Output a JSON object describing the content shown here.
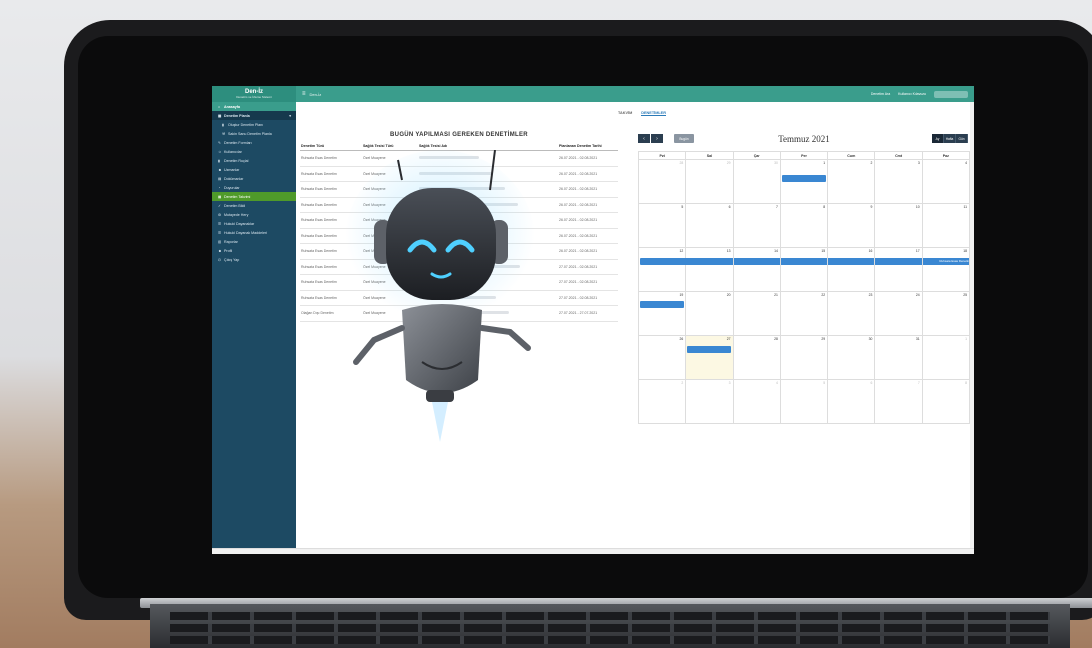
{
  "app": {
    "brand": "Den-İz",
    "brand_sub": "Denetim ve İzleme Sistemi",
    "breadcrumb": "Den-İz",
    "topbar_links": [
      "Denetim Ara",
      "Kullanıcı Kılavuzu"
    ]
  },
  "sidebar": {
    "items": [
      {
        "label": "Anasayfa",
        "icon": "home-icon",
        "kind": "active"
      },
      {
        "label": "Denetim Planla",
        "icon": "calendar-icon",
        "kind": "section"
      },
      {
        "label": "Oluştur Denetim Planı",
        "icon": "file-icon",
        "kind": "sub"
      },
      {
        "label": "Sakin Sanu Denetim Planla",
        "icon": "hammer-icon",
        "kind": "sub"
      },
      {
        "label": "Denetim Formları",
        "icon": "edit-icon",
        "kind": "normal"
      },
      {
        "label": "Kullanıcılar",
        "icon": "users-icon",
        "kind": "normal"
      },
      {
        "label": "Denetim Ruçlal",
        "icon": "file-icon",
        "kind": "normal"
      },
      {
        "label": "Uzmanlar",
        "icon": "user-icon",
        "kind": "normal"
      },
      {
        "label": "Dokümanlar",
        "icon": "doc-icon",
        "kind": "normal"
      },
      {
        "label": "Duyurular",
        "icon": "bell-icon",
        "kind": "normal"
      },
      {
        "label": "Denetim Takvimi",
        "icon": "calendar-icon",
        "kind": "highlight"
      },
      {
        "label": "Denetim Bildi",
        "icon": "check-icon",
        "kind": "normal"
      },
      {
        "label": "Mutayede Hery",
        "icon": "wrench-icon",
        "kind": "normal"
      },
      {
        "label": "Hukuki Dayanaklar",
        "icon": "list-icon",
        "kind": "normal"
      },
      {
        "label": "Hukuki Dayanak Maddeleri",
        "icon": "list-icon",
        "kind": "normal"
      },
      {
        "label": "Raporlar",
        "icon": "chart-icon",
        "kind": "normal"
      },
      {
        "label": "Profil",
        "icon": "user-icon",
        "kind": "normal"
      },
      {
        "label": "Çıkış Yap",
        "icon": "power-icon",
        "kind": "normal"
      }
    ]
  },
  "tabs": [
    "TAKVİM",
    "DENETİMLER"
  ],
  "audits": {
    "title": "BUGÜN YAPILMASI GEREKEN DENETİMLER",
    "columns": [
      "Denetim Türü",
      "Sağlık Tesisi Türü",
      "Sağlık Tesisi Adı",
      "Planlanan Denetim Tarihi"
    ],
    "rows": [
      [
        "Ruhsata Esas Denetim",
        "Özel Muayene",
        "",
        "26.07.2021 - 02.08.2021"
      ],
      [
        "Ruhsata Esas Denetim",
        "Özel Muayene",
        "",
        "26.07.2021 - 02.08.2021"
      ],
      [
        "Ruhsata Esas Denetim",
        "Özel Muayene",
        "",
        "26.07.2021 - 02.08.2021"
      ],
      [
        "Ruhsata Esas Denetim",
        "Özel Muayene",
        "",
        "26.07.2021 - 02.08.2021"
      ],
      [
        "Ruhsata Esas Denetim",
        "Özel Muayene",
        "",
        "26.07.2021 - 02.08.2021"
      ],
      [
        "Ruhsata Esas Denetim",
        "Özel Muayene",
        "",
        "26.07.2021 - 02.08.2021"
      ],
      [
        "Ruhsata Esas Denetim",
        "Özel Muayene",
        "",
        "26.07.2021 - 02.08.2021"
      ],
      [
        "Ruhsata Esas Denetim",
        "Özel Muayene",
        "",
        "27.07.2021 - 02.08.2021"
      ],
      [
        "Ruhsata Esas Denetim",
        "Özel Muayene",
        "",
        "27.07.2021 - 02.08.2021"
      ],
      [
        "Ruhsata Esas Denetim",
        "Özel Muayene",
        "",
        "27.07.2021 - 02.08.2021"
      ],
      [
        "Olağan Dışı Denetim",
        "Özel Muayene",
        "",
        "27.07.2021 - 27.07.2021"
      ]
    ]
  },
  "calendar": {
    "title": "Temmuz 2021",
    "today_label": "Bugün",
    "views": [
      "Ay",
      "Hafta",
      "Gün"
    ],
    "weekdays": [
      "Pzt",
      "Sal",
      "Çar",
      "Per",
      "Cum",
      "Cmt",
      "Paz"
    ],
    "weeks": [
      [
        [
          "28",
          true
        ],
        [
          "29",
          true
        ],
        [
          "30",
          true
        ],
        [
          "1",
          false
        ],
        [
          "2",
          false
        ],
        [
          "3",
          false
        ],
        [
          "4",
          false
        ]
      ],
      [
        [
          "5",
          false
        ],
        [
          "6",
          false
        ],
        [
          "7",
          false
        ],
        [
          "8",
          false
        ],
        [
          "9",
          false
        ],
        [
          "10",
          false
        ],
        [
          "11",
          false
        ]
      ],
      [
        [
          "12",
          false
        ],
        [
          "13",
          false
        ],
        [
          "14",
          false
        ],
        [
          "15",
          false
        ],
        [
          "16",
          false
        ],
        [
          "17",
          false
        ],
        [
          "18",
          false
        ]
      ],
      [
        [
          "19",
          false
        ],
        [
          "20",
          false
        ],
        [
          "21",
          false
        ],
        [
          "22",
          false
        ],
        [
          "23",
          false
        ],
        [
          "24",
          false
        ],
        [
          "25",
          false
        ]
      ],
      [
        [
          "26",
          false
        ],
        [
          "27",
          false
        ],
        [
          "28",
          false
        ],
        [
          "29",
          false
        ],
        [
          "30",
          false
        ],
        [
          "31",
          false
        ],
        [
          "1",
          true
        ]
      ],
      [
        [
          "2",
          true
        ],
        [
          "3",
          true
        ],
        [
          "4",
          true
        ],
        [
          "5",
          true
        ],
        [
          "6",
          true
        ],
        [
          "7",
          true
        ],
        [
          "8",
          true
        ]
      ]
    ],
    "today_day": "27",
    "event_label": "Ruhsata Esas Denetim",
    "accent": "#3a87d2"
  },
  "colors": {
    "topbar": "#3a9d8c",
    "sidebar": "#1d4a63",
    "highlight": "#4f9a2a"
  }
}
